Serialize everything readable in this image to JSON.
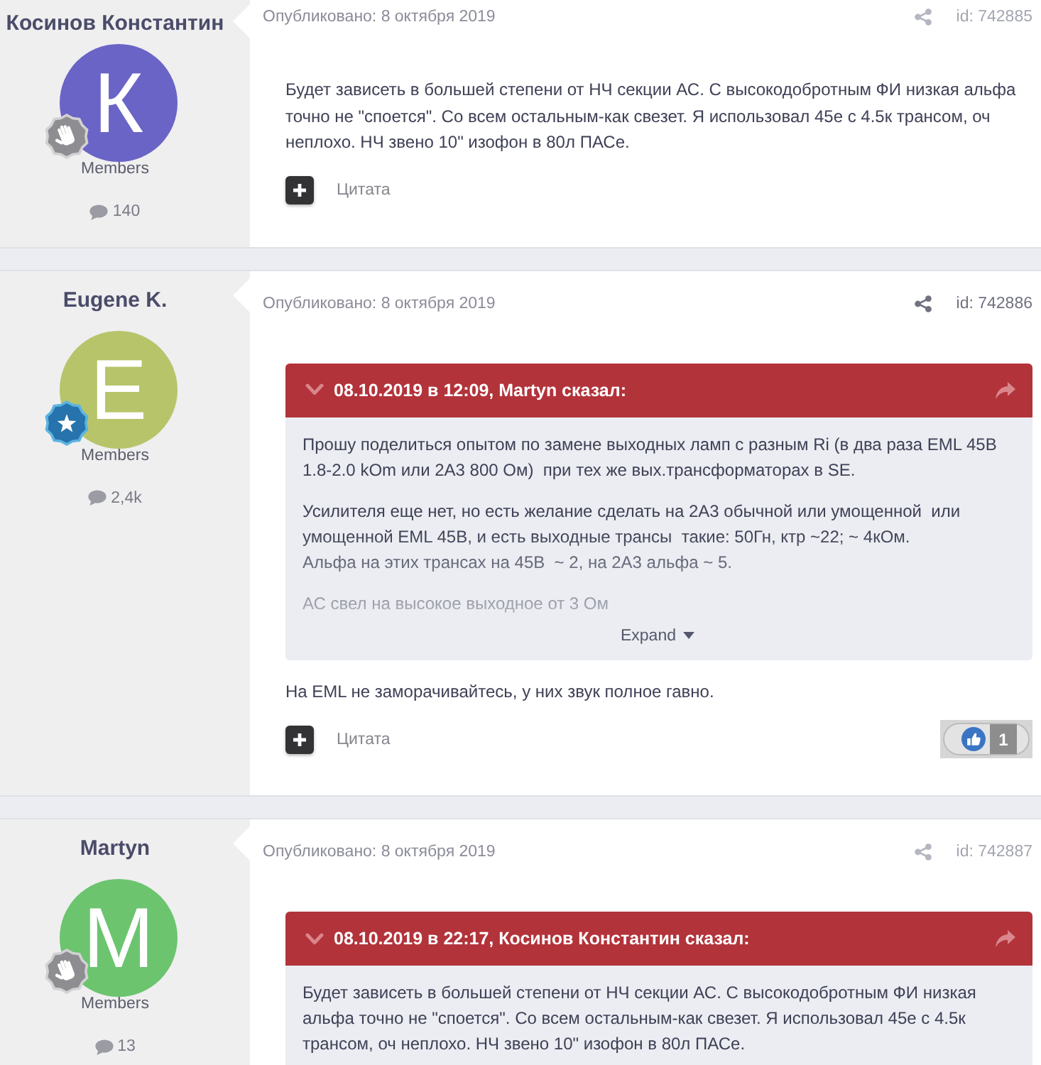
{
  "posts": [
    {
      "author": {
        "name": "Косинов Константин",
        "avatar_letter": "К",
        "color": "#6a64c6",
        "badge": {
          "kind": "hand"
        },
        "group": "Members",
        "post_count": "140"
      },
      "published": "Опубликовано: 8 октября 2019",
      "post_id": "id: 742885",
      "hovered": false,
      "content": [
        {
          "kind": "text",
          "text": "Будет зависеть в большей степени от НЧ секции АС. С высокодобротным ФИ низкая альфа точно не \"споется\". Со всем остальным-как свезет. Я использовал 45е с 4.5к трансом, оч неплохо. НЧ звено 10\" изофон в 80л ПАСе."
        }
      ],
      "quote_label": "Цитата"
    },
    {
      "author": {
        "name": "Eugene K.",
        "avatar_letter": "E",
        "color": "#b8c46a",
        "badge": {
          "kind": "star"
        },
        "group": "Members",
        "post_count": "2,4k"
      },
      "published": "Опубликовано: 8 октября 2019",
      "post_id": "id: 742886",
      "hovered": true,
      "content": [
        {
          "kind": "quote",
          "citation": "08.10.2019 в 12:09, Martyn сказал:",
          "paragraphs": [
            "Прошу поделиться опытом по замене выходных ламп с разным Ri (в два раза EML 45В 1.8-2.0 kOm или 2А3 800 Ом)  при тех же вых.трансформаторах в SE.",
            "Усилителя еще нет, но есть желание сделать на 2А3 обычной или умощенной  или умощенной EML 45В, и есть выходные трансы  такие: 50Гн, ктр ~22; ~ 4кОм.\nАльфа на этих трансах на 45В  ~ 2, на 2А3 альфа ~ 5.",
            "АС свел на высокое выходное от 3 Ом"
          ],
          "collapsed": true,
          "expand_label": "Expand"
        },
        {
          "kind": "text",
          "text": "На EML не заморачивайтесь, у них звук полное гавно."
        }
      ],
      "quote_label": "Цитата",
      "reaction": {
        "count": "1"
      }
    },
    {
      "author": {
        "name": "Martyn",
        "avatar_letter": "M",
        "color": "#6cc46f",
        "badge": {
          "kind": "hand"
        },
        "group": "Members",
        "post_count": "13"
      },
      "published": "Опубликовано: 8 октября 2019",
      "post_id": "id: 742887",
      "hovered": false,
      "content": [
        {
          "kind": "quote",
          "citation": "08.10.2019 в 22:17, Косинов Константин сказал:",
          "paragraphs": [
            "Будет зависеть в большей степени от НЧ секции АС. С высокодобротным ФИ низкая альфа точно не \"споется\". Со всем остальным-как свезет. Я использовал 45е с 4.5к трансом, оч неплохо. НЧ звено 10\" изофон в 80л ПАСе."
          ],
          "collapsed": false
        }
      ]
    }
  ]
}
